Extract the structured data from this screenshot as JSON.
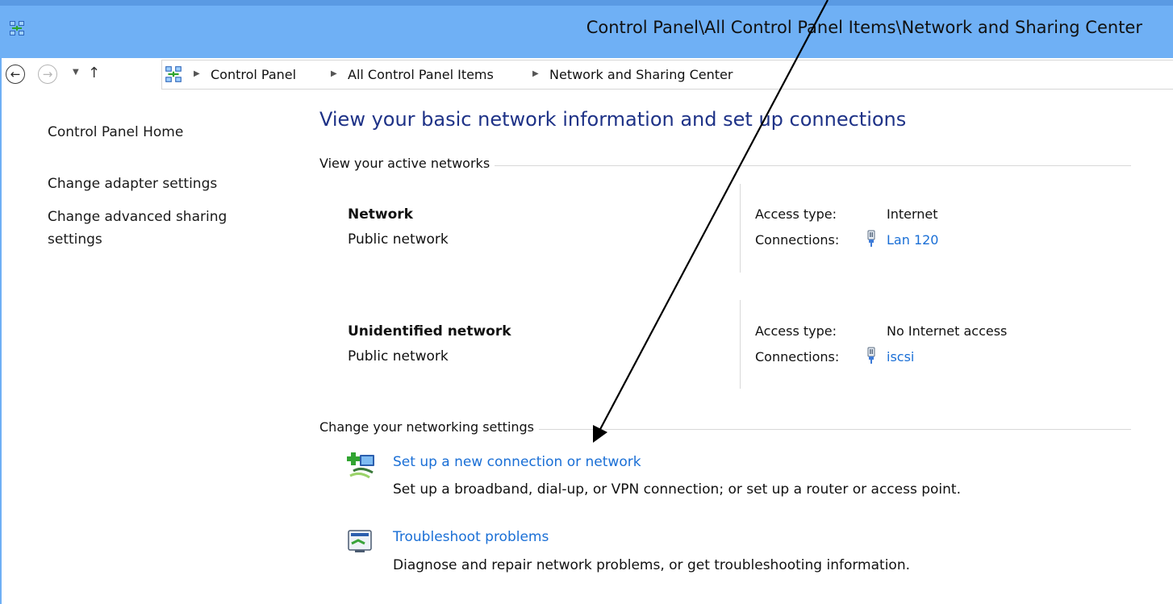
{
  "window": {
    "title": "Control Panel\\All Control Panel Items\\Network and Sharing Center",
    "icon": "network-control-panel-icon"
  },
  "nav": {
    "back_icon": "back-arrow-icon",
    "forward_icon": "forward-arrow-icon",
    "recent_icon": "chevron-down-icon",
    "up_icon": "up-arrow-icon",
    "back_glyph": "←",
    "forward_glyph": "→",
    "recent_glyph": "▼",
    "up_glyph": "↑",
    "sep_glyph": "▶",
    "breadcrumbs": [
      "Control Panel",
      "All Control Panel Items",
      "Network and Sharing Center"
    ]
  },
  "sidebar": {
    "items": [
      {
        "label": "Control Panel Home"
      },
      {
        "label": "Change adapter settings"
      },
      {
        "label": "Change advanced sharing settings"
      }
    ]
  },
  "main": {
    "heading": "View your basic network information and set up connections",
    "active_networks_label": "View your active networks",
    "networks": [
      {
        "name": "Network",
        "category": "Public network",
        "access_label": "Access type:",
        "access_value": "Internet",
        "connections_label": "Connections:",
        "connection_name": "Lan 120",
        "connection_icon": "ethernet-plug-icon"
      },
      {
        "name": "Unidentified network",
        "category": "Public network",
        "access_label": "Access type:",
        "access_value": "No Internet access",
        "connections_label": "Connections:",
        "connection_name": "iscsi",
        "connection_icon": "ethernet-plug-icon"
      }
    ],
    "settings_label": "Change your networking settings",
    "tasks": [
      {
        "title": "Set up a new connection or network",
        "description": "Set up a broadband, dial-up, or VPN connection; or set up a router or access point.",
        "icon": "new-connection-icon"
      },
      {
        "title": "Troubleshoot problems",
        "description": "Diagnose and repair network problems, or get troubleshooting information.",
        "icon": "troubleshoot-icon"
      }
    ]
  },
  "annotation": {
    "type": "arrow",
    "color": "#000000"
  },
  "colors": {
    "titlebar": "#6fb0f5",
    "heading": "#1e3287",
    "link": "#1a6fd6"
  }
}
